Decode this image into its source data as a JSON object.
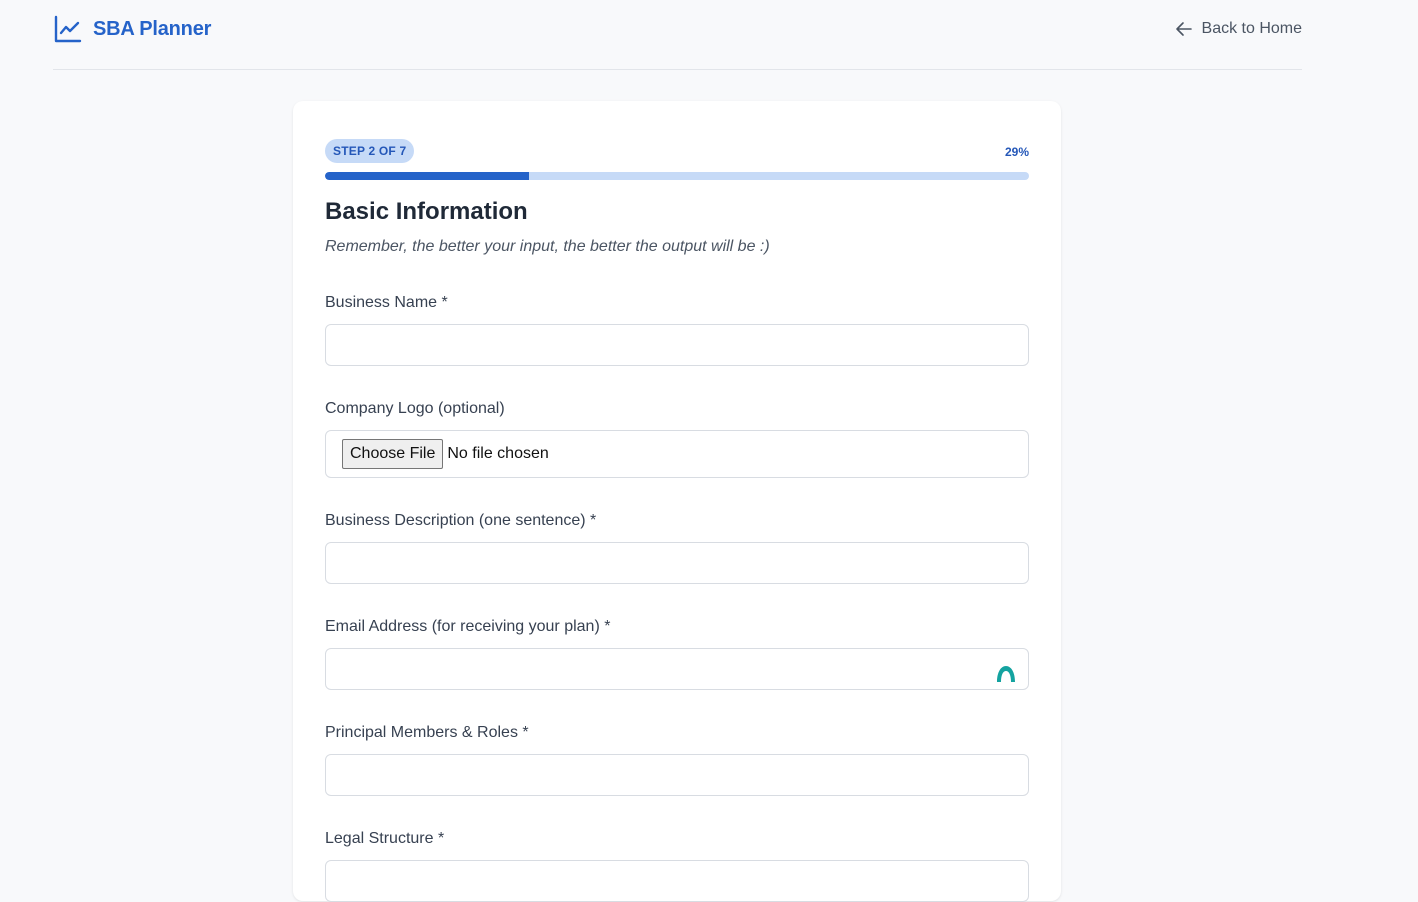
{
  "header": {
    "brand_name": "SBA Planner",
    "brand_icon": "trend-chart-icon",
    "back_label": "Back to Home",
    "back_icon": "arrow-left-icon",
    "brand_color": "#2563c9"
  },
  "progress": {
    "step_label": "STEP 2 OF 7",
    "percent_label": "29%",
    "fraction": 0.29
  },
  "section": {
    "title": "Basic Information",
    "subtitle": "Remember, the better your input, the better the output will be :)"
  },
  "fields": {
    "business_name": {
      "label": "Business Name *",
      "value": ""
    },
    "company_logo": {
      "label": "Company Logo (optional)",
      "button_label": "Choose File",
      "status": "No file chosen"
    },
    "business_description": {
      "label": "Business Description (one sentence) *",
      "value": ""
    },
    "email": {
      "label": "Email Address (for receiving your plan) *",
      "value": "",
      "widget_icon": "password-manager-icon"
    },
    "principal_members": {
      "label": "Principal Members & Roles *",
      "value": ""
    },
    "legal_structure": {
      "label": "Legal Structure *",
      "value": ""
    }
  }
}
